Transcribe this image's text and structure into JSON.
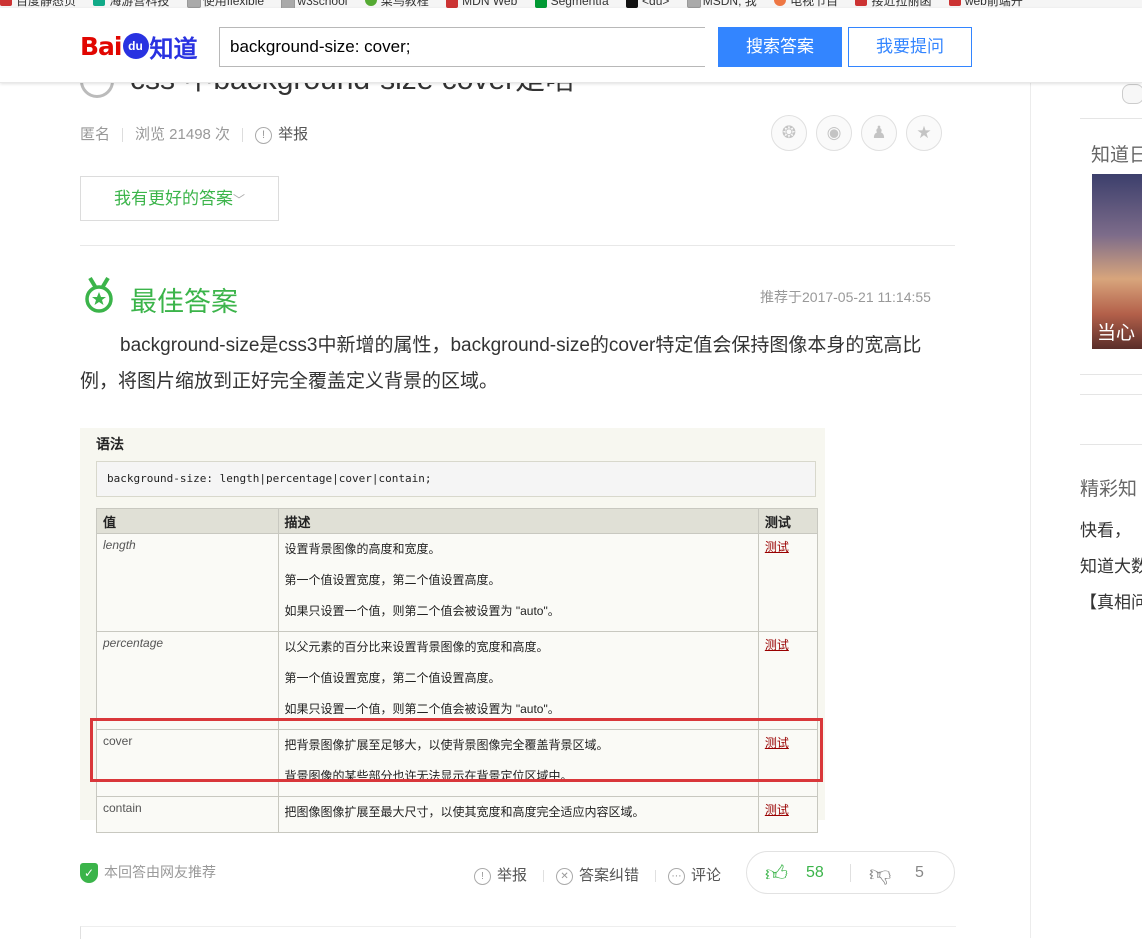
{
  "bookmarks": [
    "百度静态页",
    "海游营科技",
    "使用flexible",
    "w3school",
    "菜鸟教程",
    "MDN Web",
    "Segmentfa",
    "<du>",
    "MSDN, 我",
    "电视节目",
    "接近拉丽函",
    "web前端开"
  ],
  "header": {
    "logo_bai": "Bai",
    "logo_du": "du",
    "logo_zhidao": "知道",
    "search_value": "background-size: cover;",
    "search_button": "搜索答案",
    "ask_button": "我要提问"
  },
  "question": {
    "title": "css 中background-size cover是啥",
    "author": "匿名",
    "views": "浏览 21498 次",
    "report": "举报",
    "better_answer_button": "我有更好的答案",
    "chevron": "﹀"
  },
  "share_icons": [
    "wechat-icon",
    "weibo-icon",
    "qq-icon",
    "qzone-icon"
  ],
  "best_answer": {
    "label": "最佳答案",
    "time": "推荐于2017-05-21 11:14:55",
    "text": "background-size是css3中新增的属性，background-size的cover特定值会保持图像本身的宽高比例，将图片缩放到正好完全覆盖定义背景的区域。"
  },
  "figure": {
    "label": "语法",
    "code": "background-size: length|percentage|cover|contain;",
    "headers": [
      "值",
      "描述",
      "测试"
    ],
    "rows": [
      {
        "value": "length",
        "desc": [
          "设置背景图像的高度和宽度。",
          "第一个值设置宽度，第二个值设置高度。",
          "如果只设置一个值，则第二个值会被设置为 \"auto\"。"
        ],
        "test": "测试"
      },
      {
        "value": "percentage",
        "desc": [
          "以父元素的百分比来设置背景图像的宽度和高度。",
          "第一个值设置宽度，第二个值设置高度。",
          "如果只设置一个值，则第二个值会被设置为 \"auto\"。"
        ],
        "test": "测试"
      },
      {
        "value": "cover",
        "desc": [
          "把背景图像扩展至足够大，以使背景图像完全覆盖背景区域。",
          "背景图像的某些部分也许无法显示在背景定位区域中。"
        ],
        "test": "测试"
      },
      {
        "value": "contain",
        "desc": [
          "把图像图像扩展至最大尺寸，以使其宽度和高度完全适应内容区域。"
        ],
        "test": "测试"
      }
    ]
  },
  "footer": {
    "recommend": "本回答由网友推荐",
    "report": "举报",
    "correct": "答案纠错",
    "comment": "评论",
    "upvotes": "58",
    "downvotes": "5"
  },
  "sidebar": {
    "title": "知道日",
    "image_caption": "当心",
    "heading": "精彩知",
    "lines": [
      "快看，",
      "知道大数",
      "【真相问"
    ]
  }
}
